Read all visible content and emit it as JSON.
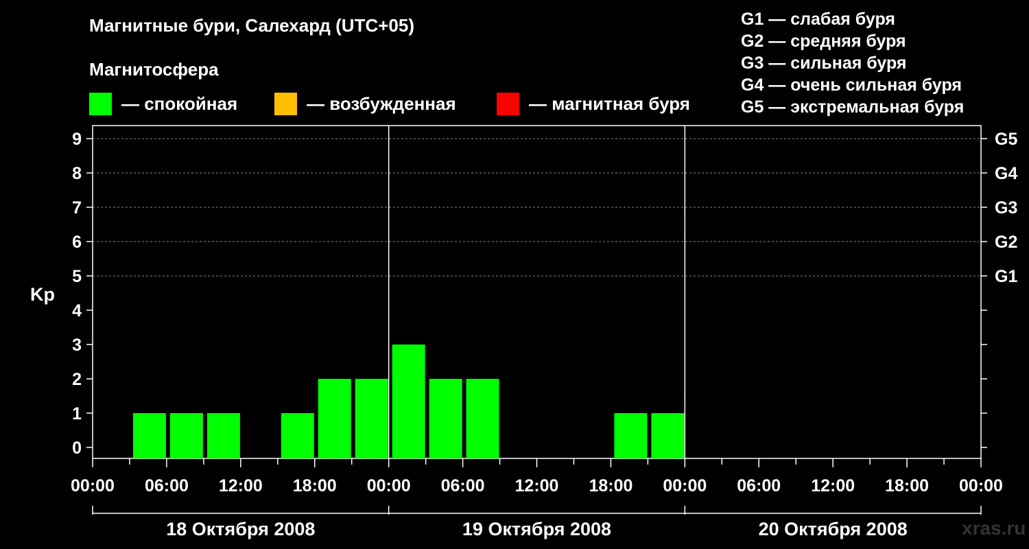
{
  "title": "Магнитные бури, Салехард (UTC+05)",
  "subtitle": "Магнитосфера",
  "legend": [
    {
      "label": "— спокойная",
      "color": "#00ff00"
    },
    {
      "label": "— возбужденная",
      "color": "#ffbf00"
    },
    {
      "label": "— магнитная буря",
      "color": "#ff0000"
    }
  ],
  "g_legend": [
    "G1 — слабая буря",
    "G2 — средняя буря",
    "G3 — сильная буря",
    "G4 — очень сильная буря",
    "G5 — экстремальная буря"
  ],
  "watermark": "xras.ru",
  "chart_data": {
    "type": "bar",
    "ylabel": "Kp",
    "ylim": [
      0,
      9
    ],
    "yticks": [
      "0",
      "1",
      "2",
      "3",
      "4",
      "5",
      "6",
      "7",
      "8",
      "9"
    ],
    "right_ticks": [
      {
        "kp": 5,
        "label": "G1"
      },
      {
        "kp": 6,
        "label": "G2"
      },
      {
        "kp": 7,
        "label": "G3"
      },
      {
        "kp": 8,
        "label": "G4"
      },
      {
        "kp": 9,
        "label": "G5"
      }
    ],
    "x_ticks": [
      "00:00",
      "06:00",
      "12:00",
      "18:00",
      "00:00",
      "06:00",
      "12:00",
      "18:00",
      "00:00",
      "06:00",
      "12:00",
      "18:00",
      "00:00"
    ],
    "dates": [
      "18 Октября 2008",
      "19 Октября 2008",
      "20 Октября 2008"
    ],
    "interval_hours": 3,
    "bars": [
      {
        "start": "2008-10-18 03:00",
        "kp": 1,
        "color": "#00ff00"
      },
      {
        "start": "2008-10-18 06:00",
        "kp": 1,
        "color": "#00ff00"
      },
      {
        "start": "2008-10-18 09:00",
        "kp": 1,
        "color": "#00ff00"
      },
      {
        "start": "2008-10-18 12:00",
        "kp": 0,
        "color": "#00ff00"
      },
      {
        "start": "2008-10-18 15:00",
        "kp": 1,
        "color": "#00ff00"
      },
      {
        "start": "2008-10-18 18:00",
        "kp": 2,
        "color": "#00ff00"
      },
      {
        "start": "2008-10-18 21:00",
        "kp": 2,
        "color": "#00ff00"
      },
      {
        "start": "2008-10-19 00:00",
        "kp": 3,
        "color": "#00ff00"
      },
      {
        "start": "2008-10-19 03:00",
        "kp": 2,
        "color": "#00ff00"
      },
      {
        "start": "2008-10-19 06:00",
        "kp": 2,
        "color": "#00ff00"
      },
      {
        "start": "2008-10-19 18:00",
        "kp": 1,
        "color": "#00ff00"
      },
      {
        "start": "2008-10-19 21:00",
        "kp": 1,
        "color": "#00ff00"
      }
    ],
    "grid": "dashed gridlines at Kp 5–9"
  }
}
